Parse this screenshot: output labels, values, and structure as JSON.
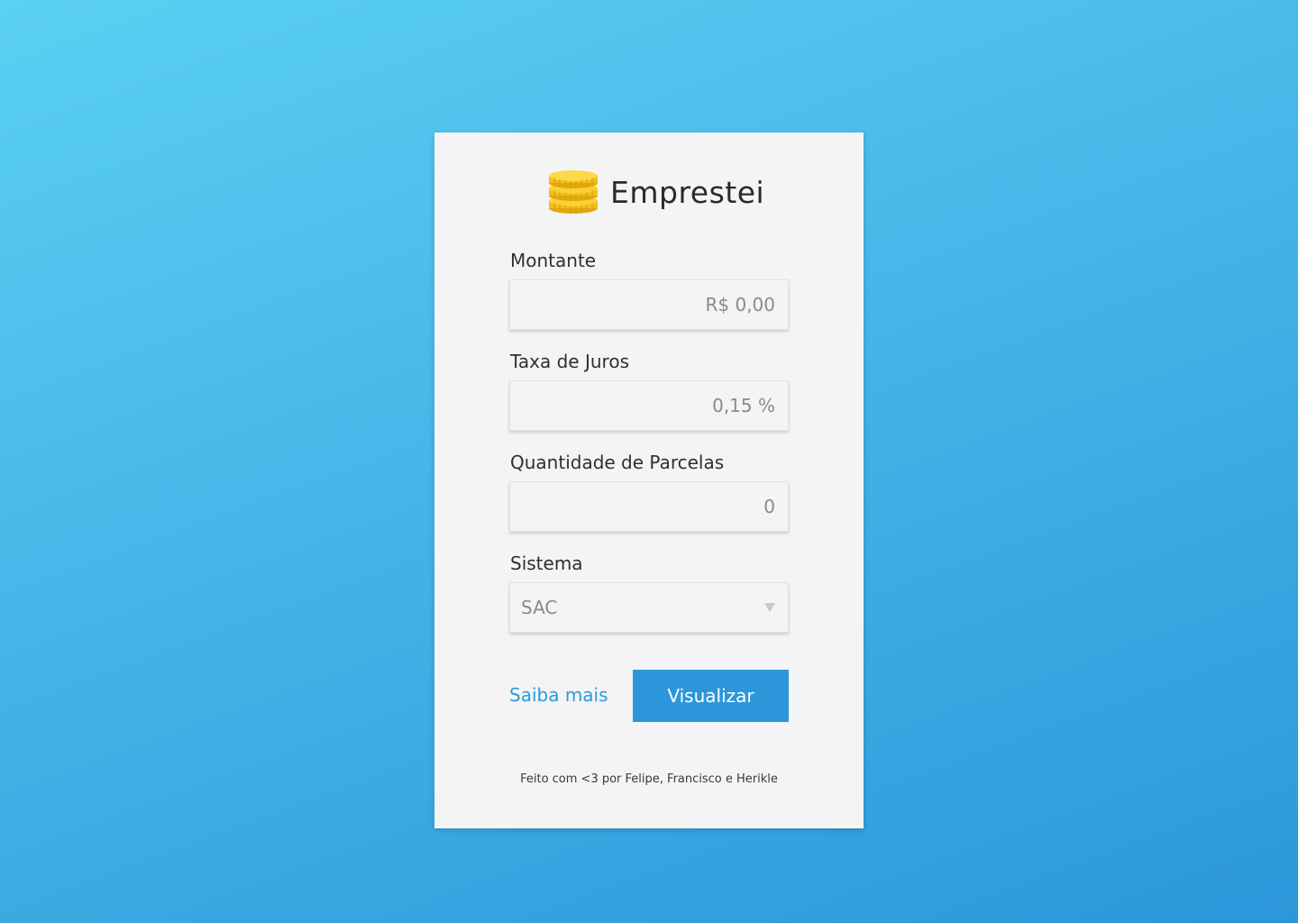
{
  "app": {
    "title": "Emprestei",
    "logo_icon": "coin-stack-icon"
  },
  "form": {
    "amount": {
      "label": "Montante",
      "placeholder": "R$ 0,00"
    },
    "interest_rate": {
      "label": "Taxa de Juros",
      "placeholder": "0,15 %"
    },
    "installments": {
      "label": "Quantidade de Parcelas",
      "placeholder": "0"
    },
    "system": {
      "label": "Sistema",
      "selected": "SAC",
      "icon": "chevron-down-icon"
    }
  },
  "actions": {
    "learn_more": "Saiba mais",
    "submit": "Visualizar"
  },
  "footer": {
    "text": "Feito com <3 por Felipe, Francisco e Herikle"
  },
  "colors": {
    "background_start": "#5ad0f3",
    "background_end": "#2b97da",
    "accent": "#2b97da",
    "card": "#f4f4f4",
    "coin": "#f6c21c"
  }
}
